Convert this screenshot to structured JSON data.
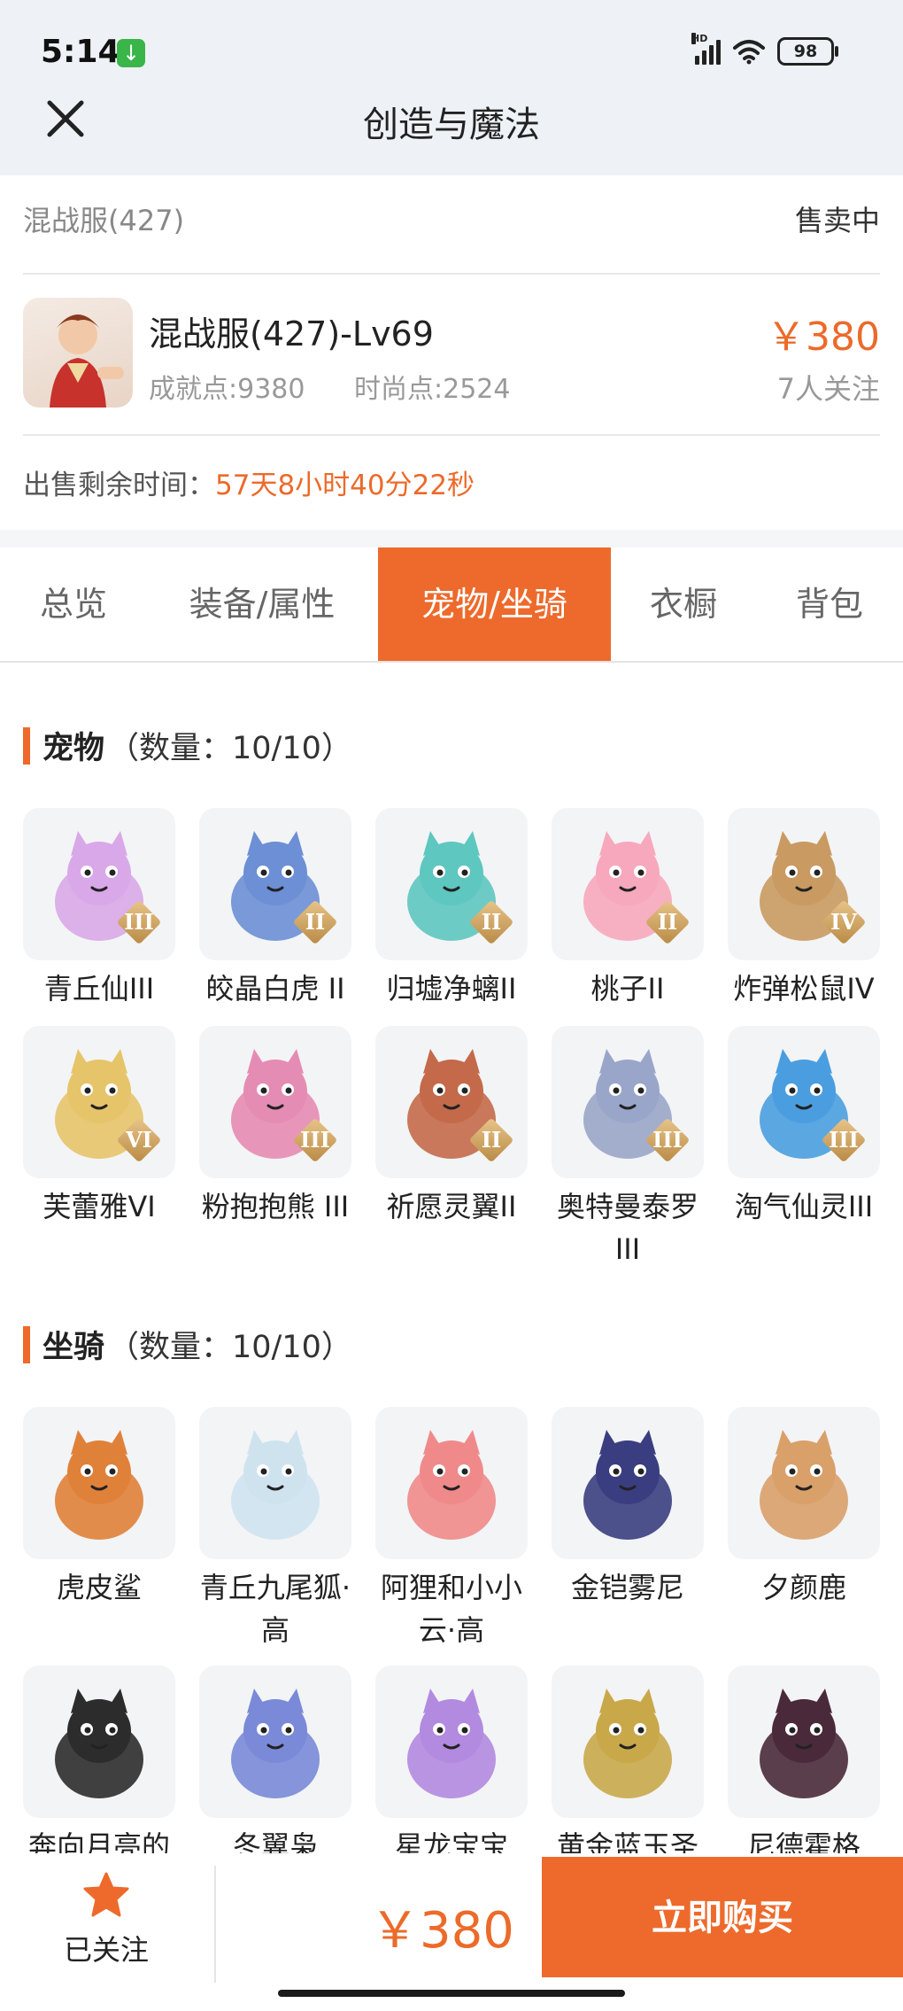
{
  "status_bar": {
    "time": "5:14",
    "battery": "98",
    "network": "HD"
  },
  "header": {
    "title": "创造与魔法"
  },
  "listing": {
    "server": "混战服(427)",
    "status": "售卖中",
    "item_title": "混战服(427)-Lv69",
    "achievement": "成就点:9380",
    "fashion": "时尚点:2524",
    "price": "￥380",
    "followers": "7人关注",
    "remaining_label": "出售剩余时间：",
    "remaining_value": "57天8小时40分22秒"
  },
  "tabs": [
    {
      "label": "总览",
      "active": false
    },
    {
      "label": "装备/属性",
      "active": false
    },
    {
      "label": "宠物/坐骑",
      "active": true
    },
    {
      "label": "衣橱",
      "active": false
    },
    {
      "label": "背包",
      "active": false
    }
  ],
  "pets": {
    "title": "宠物",
    "count": "（数量：10/10）",
    "items": [
      {
        "name": "青丘仙III",
        "tier": "III",
        "color": "#d9a8e8"
      },
      {
        "name": "皎晶白虎 II",
        "tier": "II",
        "color": "#6c8fd6"
      },
      {
        "name": "归墟净螭II",
        "tier": "II",
        "color": "#5ec7c0"
      },
      {
        "name": "桃子II",
        "tier": "II",
        "color": "#f7a8bd"
      },
      {
        "name": "炸弹松鼠IV",
        "tier": "IV",
        "color": "#c99a62"
      },
      {
        "name": "芙蕾雅VI",
        "tier": "VI",
        "color": "#e6c46a"
      },
      {
        "name": "粉抱抱熊 III",
        "tier": "III",
        "color": "#e58cb4"
      },
      {
        "name": "祈愿灵翼II",
        "tier": "II",
        "color": "#c46a4a"
      },
      {
        "name": "奥特曼泰罗III",
        "tier": "III",
        "color": "#9aa6c9"
      },
      {
        "name": "淘气仙灵III",
        "tier": "III",
        "color": "#4a9ee0"
      }
    ]
  },
  "mounts": {
    "title": "坐骑",
    "count": "（数量：10/10）",
    "items": [
      {
        "name": "虎皮鲨",
        "color": "#e0813a"
      },
      {
        "name": "青丘九尾狐·高",
        "color": "#cfe3ef"
      },
      {
        "name": "阿狸和小小云·高",
        "color": "#f08a8a"
      },
      {
        "name": "金铠雾尼",
        "color": "#3a3e80"
      },
      {
        "name": "夕颜鹿",
        "color": "#d9a06a"
      },
      {
        "name": "奔向月亮的",
        "color": "#2c2c2c"
      },
      {
        "name": "冬翼枭",
        "color": "#7a8ad8"
      },
      {
        "name": "星龙宝宝",
        "color": "#b28ae0"
      },
      {
        "name": "黄金蓝玉圣",
        "color": "#c9a84a"
      },
      {
        "name": "尼德霍格",
        "color": "#4a2a3a"
      }
    ]
  },
  "bottom_bar": {
    "follow_label": "已关注",
    "price": "￥380",
    "buy_label": "立即购买"
  },
  "colors": {
    "accent": "#ed6a2c",
    "price": "#ec6a2a",
    "header_bg": "#eef2f7"
  }
}
